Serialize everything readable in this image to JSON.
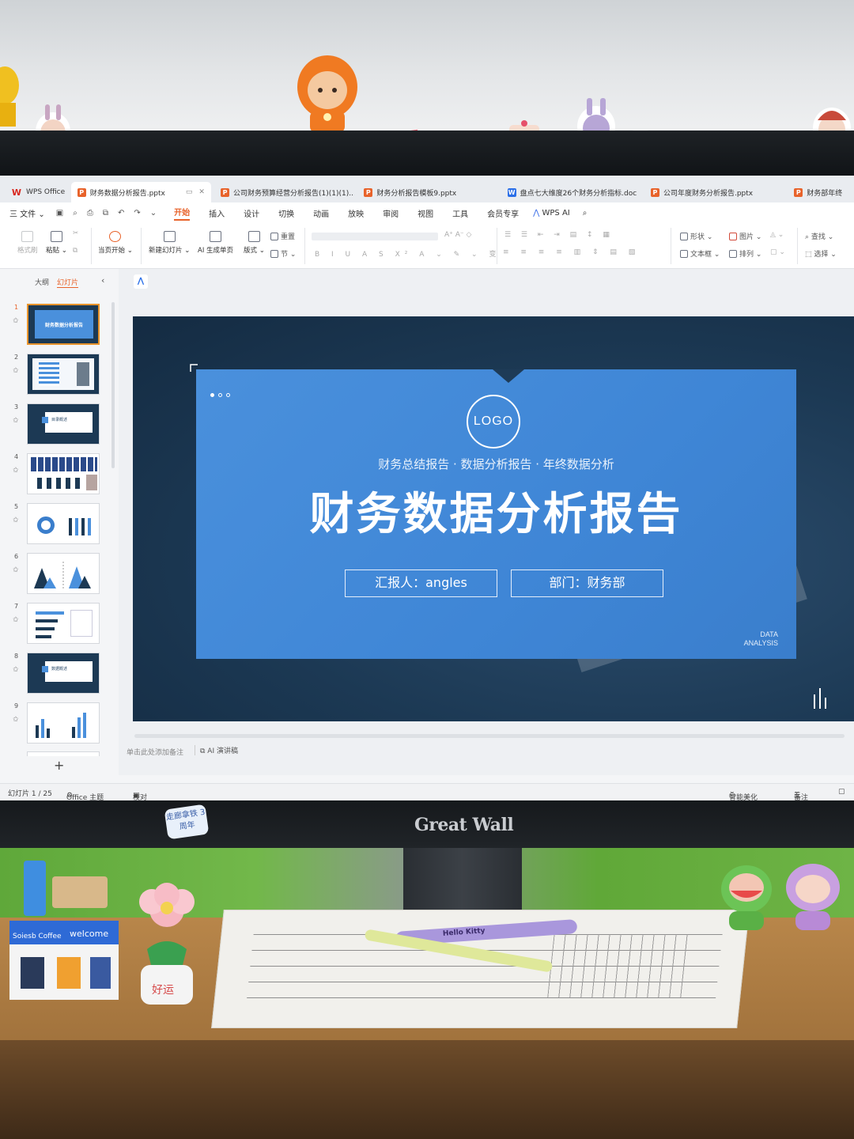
{
  "scene": {
    "monitor_brand": "Great Wall",
    "bezel_sticker": "走廊拿铁 3周年",
    "shop_sign_top": "welcome",
    "shop_sign_side": "Soiesb Coffee",
    "paper_clip_text": "Hello Kitty",
    "pot_text": "好运"
  },
  "tabs": [
    {
      "icon": "W",
      "kind": "wps",
      "label": "WPS Office",
      "active": false
    },
    {
      "icon": "P",
      "kind": "p",
      "label": "财务数据分析报告.pptx",
      "active": true
    },
    {
      "icon": "P",
      "kind": "p",
      "label": "公司财务预算经营分析报告(1)(1)(1)...",
      "active": false
    },
    {
      "icon": "P",
      "kind": "p",
      "label": "财务分析报告模板9.pptx",
      "active": false
    },
    {
      "icon": "W",
      "kind": "w",
      "label": "盘点七大维度26个财务分析指标.doc",
      "active": false
    },
    {
      "icon": "P",
      "kind": "p",
      "label": "公司年度财务分析报告.pptx",
      "active": false
    },
    {
      "icon": "P",
      "kind": "p",
      "label": "财务部年终",
      "active": false
    }
  ],
  "menu": {
    "file": "三 文件 ⌄",
    "items": [
      "开始",
      "插入",
      "设计",
      "切换",
      "动画",
      "放映",
      "审阅",
      "视图",
      "工具",
      "会员专享"
    ],
    "wps_ai": "WPS AI"
  },
  "ribbon": {
    "format_painter": "格式刷",
    "paste": "粘贴",
    "play_from_current": "当页开始",
    "new_slide": "新建幻灯片",
    "ai_generate": "AI 生成单页",
    "layout": "版式",
    "reset": "重置",
    "section": "节",
    "shape": "形状",
    "picture": "图片",
    "textbox": "文本框",
    "arrange": "排列",
    "find": "查找",
    "select": "选择"
  },
  "left_panel": {
    "outline_tab": "大纲",
    "slides_tab": "幻灯片",
    "thumb_numbers": [
      "1",
      "2",
      "3",
      "4",
      "5",
      "6",
      "7",
      "8",
      "9"
    ],
    "thumb1_title": "财务数据分析报告",
    "thumb3_title": "目录概述",
    "thumb8_title": "数据概述"
  },
  "slide": {
    "logo": "LOGO",
    "subtitle": "财务总结报告 · 数据分析报告 · 年终数据分析",
    "title": "财务数据分析报告",
    "reporter": "汇报人：angles",
    "department": "部门：财务部",
    "corner_text_line1": "DATA",
    "corner_text_line2": "ANALYSIS"
  },
  "notes": {
    "placeholder": "单击此处添加备注",
    "ai_notes": "AI 演讲稿"
  },
  "status": {
    "slide_counter": "幻灯片 1 / 25",
    "theme": "Office 主题",
    "proofread": "校对",
    "smart_beautify": "智能美化",
    "notes_toggle": "备注"
  },
  "colors": {
    "accent": "#e8632b",
    "slide_panel": "#4a90dc",
    "slide_bg": "#1c3954"
  }
}
